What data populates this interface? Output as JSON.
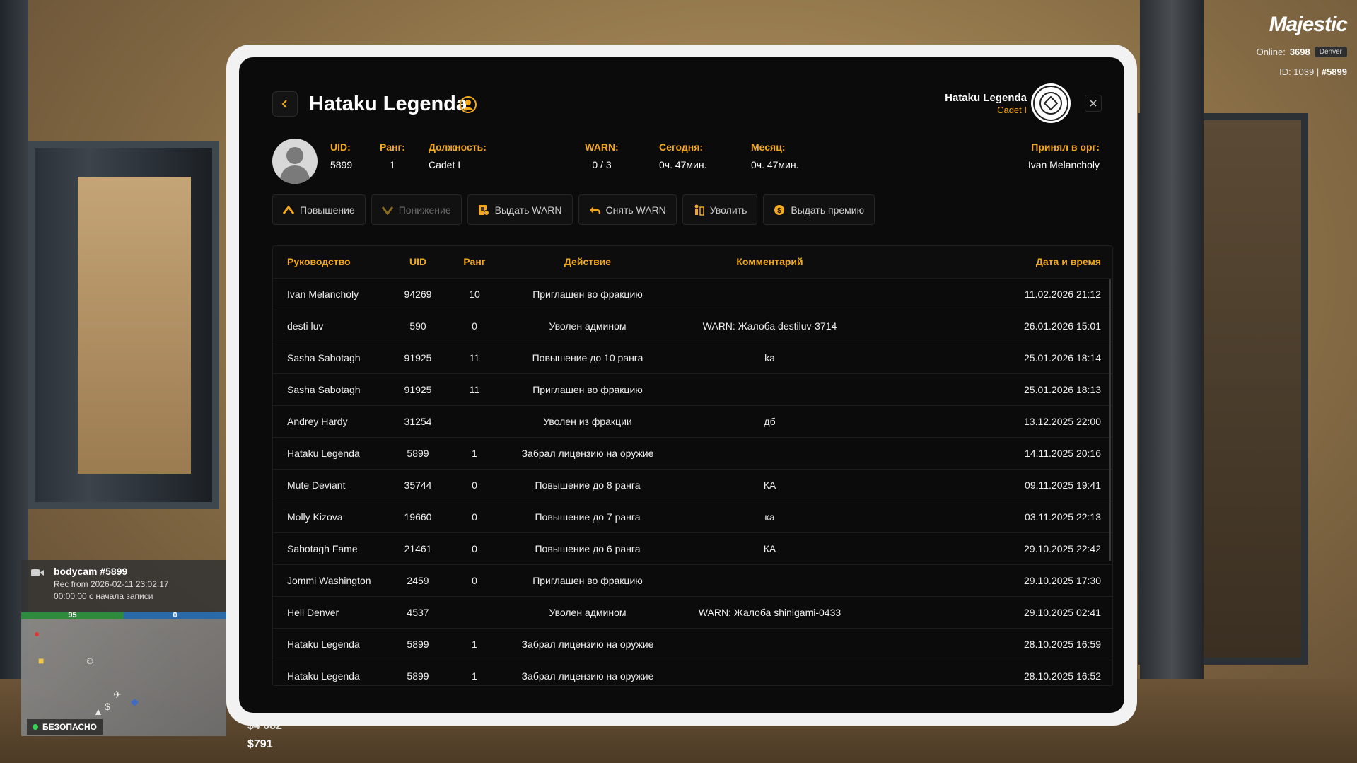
{
  "hud": {
    "logo": "Majestic",
    "online_label": "Online:",
    "online_count": "3698",
    "server": "Denver",
    "id_label": "ID: 1039 |",
    "id_value": "#5899"
  },
  "bodycam": {
    "title": "bodycam #5899",
    "rec": "Rec from 2026-02-11 23:02:17",
    "elapsed": "00:00:00 с начала записи"
  },
  "status_bars": {
    "health": "95",
    "armor": "0",
    "health_fraction": 0.5
  },
  "zone_label": "БЕЗОПАСНО",
  "money": {
    "bank": "$4 082",
    "cash": "$791"
  },
  "header": {
    "name": "Hataku Legenda",
    "user_name": "Hataku Legenda",
    "user_rank": "Cadet I"
  },
  "profile": {
    "uid_label": "UID:",
    "uid": "5899",
    "rank_label": "Ранг:",
    "rank": "1",
    "position_label": "Должность:",
    "position": "Cadet I",
    "warn_label": "WARN:",
    "warn": "0 / 3",
    "today_label": "Сегодня:",
    "today": "0ч. 47мин.",
    "month_label": "Месяц:",
    "month": "0ч. 47мин.",
    "hired_by_label": "Принял в орг:",
    "hired_by": "Ivan Melancholy"
  },
  "actions": {
    "promote": "Повышение",
    "demote": "Понижение",
    "give_warn": "Выдать WARN",
    "remove_warn": "Снять WARN",
    "fire": "Уволить",
    "give_bonus": "Выдать премию"
  },
  "table": {
    "headers": {
      "leader": "Руководство",
      "uid": "UID",
      "rank": "Ранг",
      "action": "Действие",
      "comment": "Комментарий",
      "datetime": "Дата и время"
    },
    "rows": [
      {
        "leader": "Ivan Melancholy",
        "uid": "94269",
        "rank": "10",
        "action": "Приглашен во фракцию",
        "comment": "",
        "datetime": "11.02.2026 21:12"
      },
      {
        "leader": "desti luv",
        "uid": "590",
        "rank": "0",
        "action": "Уволен админом",
        "comment": "WARN: Жалоба destiluv-3714",
        "datetime": "26.01.2026 15:01"
      },
      {
        "leader": "Sasha Sabotagh",
        "uid": "91925",
        "rank": "11",
        "action": "Повышение до 10 ранга",
        "comment": "ka",
        "datetime": "25.01.2026 18:14"
      },
      {
        "leader": "Sasha Sabotagh",
        "uid": "91925",
        "rank": "11",
        "action": "Приглашен во фракцию",
        "comment": "",
        "datetime": "25.01.2026 18:13"
      },
      {
        "leader": "Andrey Hardy",
        "uid": "31254",
        "rank": "",
        "action": "Уволен из фракции",
        "comment": "дб",
        "datetime": "13.12.2025 22:00"
      },
      {
        "leader": "Hataku Legenda",
        "uid": "5899",
        "rank": "1",
        "action": "Забрал лицензию на оружие",
        "comment": "",
        "datetime": "14.11.2025 20:16"
      },
      {
        "leader": "Mute Deviant",
        "uid": "35744",
        "rank": "0",
        "action": "Повышение до 8 ранга",
        "comment": "КА",
        "datetime": "09.11.2025 19:41"
      },
      {
        "leader": "Molly Kizova",
        "uid": "19660",
        "rank": "0",
        "action": "Повышение до 7 ранга",
        "comment": "ка",
        "datetime": "03.11.2025 22:13"
      },
      {
        "leader": "Sabotagh Fame",
        "uid": "21461",
        "rank": "0",
        "action": "Повышение до 6 ранга",
        "comment": "КА",
        "datetime": "29.10.2025 22:42"
      },
      {
        "leader": "Jommi Washington",
        "uid": "2459",
        "rank": "0",
        "action": "Приглашен во фракцию",
        "comment": "",
        "datetime": "29.10.2025 17:30"
      },
      {
        "leader": "Hell Denver",
        "uid": "4537",
        "rank": "",
        "action": "Уволен админом",
        "comment": "WARN: Жалоба shinigami-0433",
        "datetime": "29.10.2025 02:41"
      },
      {
        "leader": "Hataku Legenda",
        "uid": "5899",
        "rank": "1",
        "action": "Забрал лицензию на оружие",
        "comment": "",
        "datetime": "28.10.2025 16:59"
      },
      {
        "leader": "Hataku Legenda",
        "uid": "5899",
        "rank": "1",
        "action": "Забрал лицензию на оружие",
        "comment": "",
        "datetime": "28.10.2025 16:52"
      }
    ]
  },
  "colors": {
    "accent": "#f3a91b",
    "panel": "#0b0b0b",
    "frame": "#f2f2f2"
  }
}
